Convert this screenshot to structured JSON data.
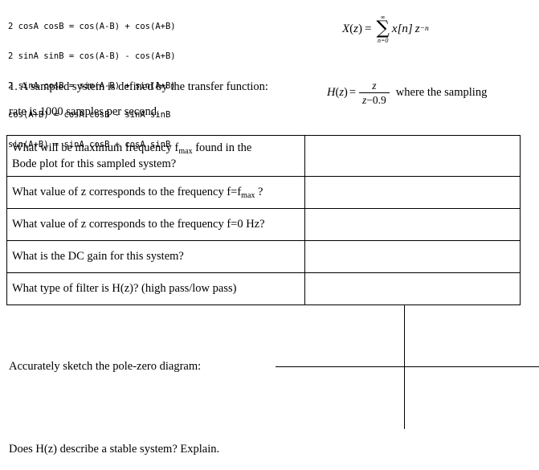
{
  "trig_identities": {
    "lines": [
      "2 cosA cosB = cos(A-B) + cos(A+B)",
      "2 sinA sinB = cos(A-B) - cos(A+B)",
      "2 sinA cosB = sin(A-B) + sin(A+B)",
      "cos(A+B) = cosA cosB - sinA sinB",
      "sin(A+B) = sinA cosB + cosA sinB"
    ]
  },
  "ztransform": {
    "lhs": "X",
    "lhs_open": "(",
    "lhs_var": "z",
    "lhs_close": ")",
    "equals": "=",
    "sum_upper": "∞",
    "sum_symbol": "∑",
    "sum_lower": "n=0",
    "term_x": "x",
    "term_index": "[n]",
    "term_z": "z",
    "term_exp": "−n"
  },
  "problem": {
    "line1": "1. A sampled system is defined by the transfer function:",
    "line2": "rate is 1000 samples per second.",
    "hz_label": "H",
    "hz_open": "(",
    "hz_var": "z",
    "hz_close": ")",
    "hz_equals": "=",
    "hz_numerator": "z",
    "hz_denominator_var": "z",
    "hz_denominator_rest": "−0.9",
    "hz_trailing": "where the sampling"
  },
  "table": {
    "rows": [
      {
        "question_part1": "What will be maximum frequency f",
        "question_sub": "max",
        "question_part2": " found in the",
        "question_line2": "Bode plot for this sampled system?",
        "answer": ""
      },
      {
        "question_part1": "What value of z corresponds to the frequency f=f",
        "question_sub": "max",
        "question_part2": " ?",
        "question_line2": "",
        "answer": ""
      },
      {
        "question_part1": "What value of z corresponds to the frequency f=0 Hz?",
        "question_sub": "",
        "question_part2": "",
        "question_line2": "",
        "answer": ""
      },
      {
        "question_part1": "What is the DC gain for this system?",
        "question_sub": "",
        "question_part2": "",
        "question_line2": "",
        "answer": ""
      },
      {
        "question_part1": "What type of filter is H(z)? (high pass/low pass)",
        "question_sub": "",
        "question_part2": "",
        "question_line2": "",
        "answer": ""
      }
    ]
  },
  "sketch": {
    "label": "Accurately sketch the pole-zero diagram:"
  },
  "final_question": {
    "text": "Does H(z) describe a stable system? Explain."
  }
}
